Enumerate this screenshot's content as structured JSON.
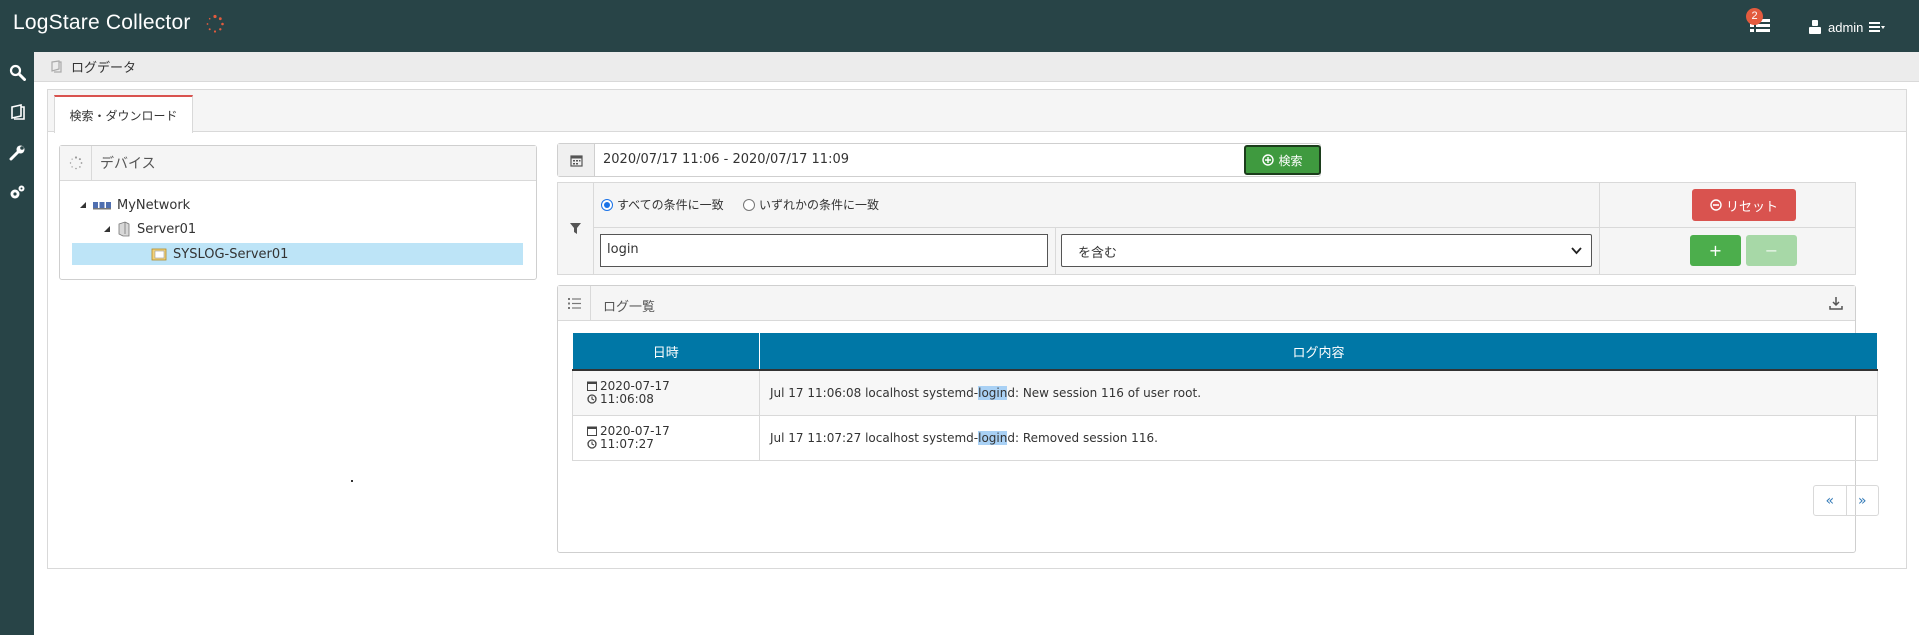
{
  "header": {
    "app_title": "LogStare Collector",
    "notification_count": "2",
    "username": "admin"
  },
  "breadcrumb": {
    "label": "ログデータ"
  },
  "tab": {
    "label": "検索・ダウンロード"
  },
  "devices": {
    "title": "デバイス",
    "tree": [
      {
        "label": "MyNetwork"
      },
      {
        "label": "Server01"
      },
      {
        "label": "SYSLOG-Server01",
        "selected": true
      }
    ]
  },
  "search": {
    "date_range": "2020/07/17 11:06 - 2020/07/17 11:09",
    "search_button": "検索",
    "match_all_label": "すべての条件に一致",
    "match_any_label": "いずれかの条件に一致",
    "reset_button": "リセット",
    "keyword_value": "login",
    "condition_selected": "を含む",
    "add_button": "+",
    "remove_button": "−"
  },
  "log_list": {
    "title": "ログ一覧",
    "columns": [
      "日時",
      "ログ内容"
    ],
    "rows": [
      {
        "date": "2020-07-17",
        "time": "11:06:08",
        "pre": "Jul 17 11:06:08 localhost systemd-",
        "hit": "login",
        "post": "d: New session 116 of user root."
      },
      {
        "date": "2020-07-17",
        "time": "11:07:27",
        "pre": "Jul 17 11:07:27 localhost systemd-",
        "hit": "login",
        "post": "d: Removed session 116."
      }
    ],
    "pager_prev": "«",
    "pager_next": "»"
  },
  "colors": {
    "header_bg": "#284447",
    "table_header": "#0077a6",
    "search_green": "#3f9a3f",
    "reset_red": "#d9534f",
    "selection": "#bde4f7"
  }
}
